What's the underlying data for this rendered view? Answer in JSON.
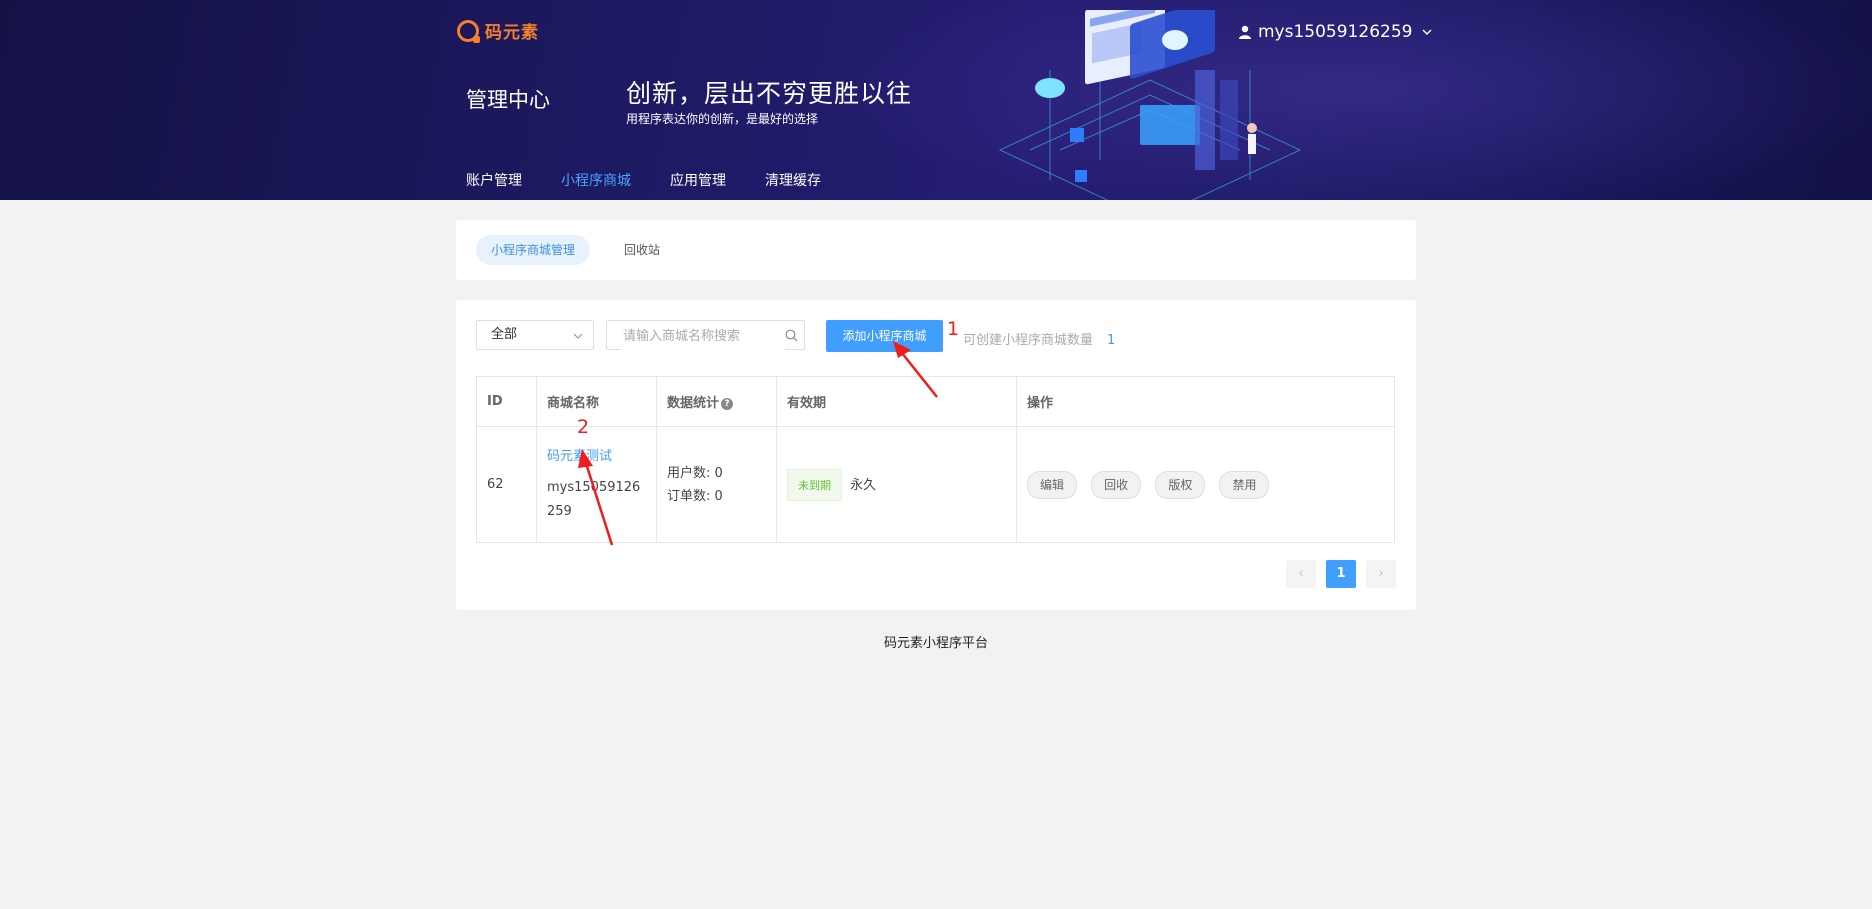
{
  "logo": {
    "text": "码元素"
  },
  "header": {
    "admin_title": "管理中心",
    "slogan_main": "创新，层出不穷更胜以往",
    "slogan_sub": "用程序表达你的创新，是最好的选择",
    "user": "mys15059126259"
  },
  "nav": [
    {
      "label": "账户管理"
    },
    {
      "label": "小程序商城",
      "active": true
    },
    {
      "label": "应用管理"
    },
    {
      "label": "清理缓存"
    }
  ],
  "subtabs": [
    {
      "label": "小程序商城管理",
      "active": true
    },
    {
      "label": "回收站"
    }
  ],
  "filter": {
    "select_value": "全部",
    "search_placeholder": "请输入商城名称搜索",
    "add_button": "添加小程序商城",
    "quota_label": "可创建小程序商城数量",
    "quota_value": "1"
  },
  "table": {
    "headers": [
      "ID",
      "商城名称",
      "数据统计",
      "有效期",
      "操作"
    ],
    "rows": [
      {
        "id": "62",
        "name": "码元素测试",
        "owner": "mys15059126259",
        "users": "用户数: 0",
        "orders": "订单数: 0",
        "badge": "未到期",
        "validity": "永久",
        "ops": [
          "编辑",
          "回收",
          "版权",
          "禁用"
        ]
      }
    ]
  },
  "pager": {
    "prev": "‹",
    "current": "1",
    "next": "›"
  },
  "footer": "码元素小程序平台",
  "annotations": {
    "one": "1",
    "two": "2"
  },
  "colors": {
    "accent": "#409eff",
    "brand": "#f5802b",
    "annotation": "#f01d1d",
    "header_bg": "#1d1a63"
  }
}
